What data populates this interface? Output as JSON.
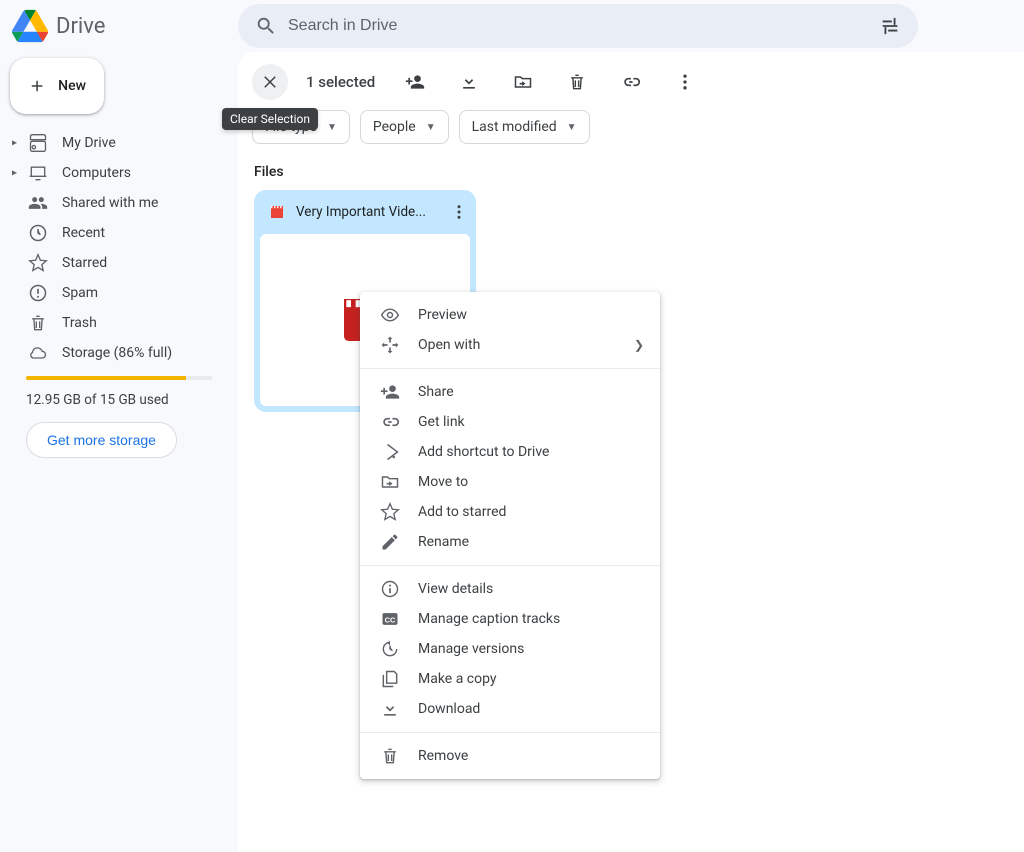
{
  "app": {
    "title": "Drive"
  },
  "search": {
    "placeholder": "Search in Drive"
  },
  "sidebar": {
    "new_label": "New",
    "items": [
      {
        "label": "My Drive"
      },
      {
        "label": "Computers"
      },
      {
        "label": "Shared with me"
      },
      {
        "label": "Recent"
      },
      {
        "label": "Starred"
      },
      {
        "label": "Spam"
      },
      {
        "label": "Trash"
      },
      {
        "label": "Storage (86% full)"
      }
    ],
    "storage_used_line": "12.95 GB of 15 GB used",
    "get_storage_label": "Get more storage",
    "storage_pct": 86
  },
  "selection": {
    "count_label": "1 selected"
  },
  "tooltip": {
    "clear_selection": "Clear Selection"
  },
  "filters": {
    "type": "File type",
    "people": "People",
    "modified": "Last modified"
  },
  "section": {
    "files": "Files"
  },
  "file": {
    "name": "Very Important Vide..."
  },
  "context_menu": {
    "preview": "Preview",
    "open_with": "Open with",
    "share": "Share",
    "get_link": "Get link",
    "add_shortcut": "Add shortcut to Drive",
    "move_to": "Move to",
    "add_to_starred": "Add to starred",
    "rename": "Rename",
    "view_details": "View details",
    "manage_captions": "Manage caption tracks",
    "manage_versions": "Manage versions",
    "make_a_copy": "Make a copy",
    "download": "Download",
    "remove": "Remove"
  }
}
